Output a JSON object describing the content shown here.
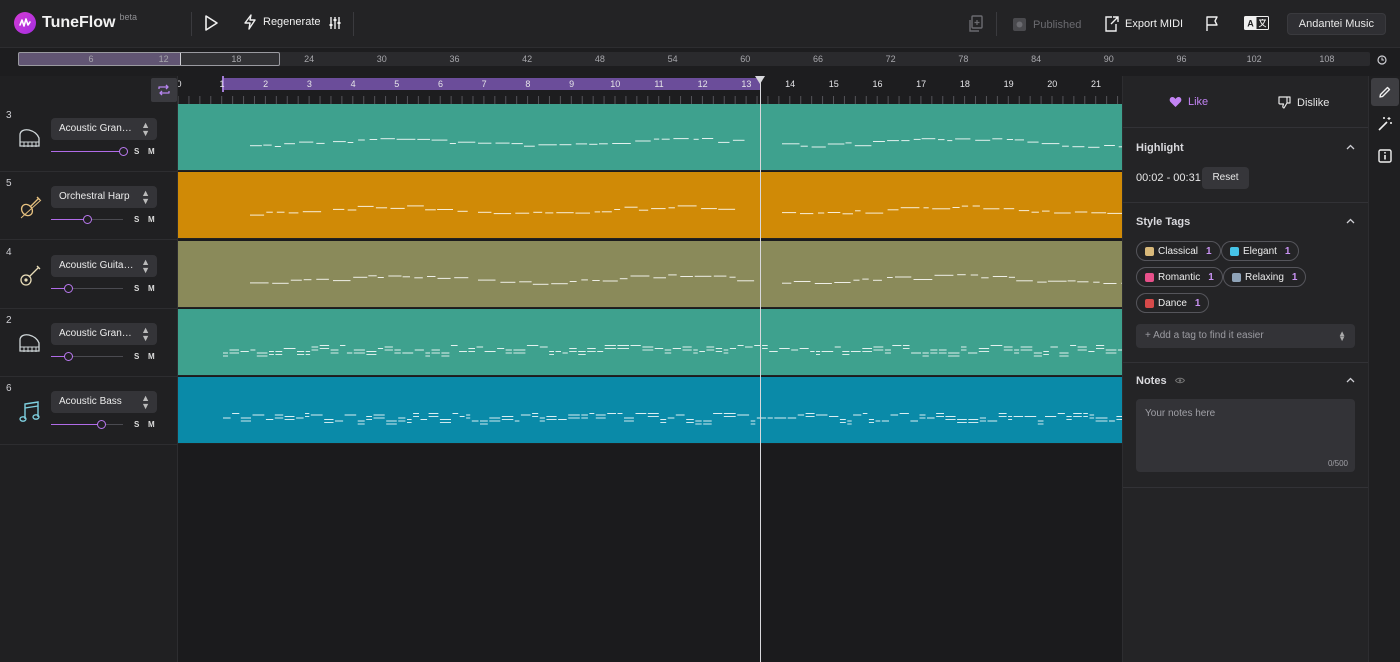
{
  "app": {
    "name": "TuneFlow",
    "badge": "beta"
  },
  "toolbar": {
    "regenerate_label": "Regenerate",
    "published_label": "Published",
    "export_label": "Export MIDI",
    "account_label": "Andantei Music"
  },
  "overview": {
    "labels": [
      "6",
      "12",
      "18",
      "24",
      "30",
      "36",
      "42",
      "48",
      "54",
      "60",
      "66",
      "72",
      "78",
      "84",
      "90",
      "96",
      "102",
      "108"
    ]
  },
  "ruler": {
    "labels": [
      "0",
      "1",
      "2",
      "3",
      "4",
      "5",
      "6",
      "7",
      "8",
      "9",
      "10",
      "11",
      "12",
      "13",
      "14",
      "15",
      "16",
      "17",
      "18",
      "19",
      "20",
      "21"
    ]
  },
  "tracks": [
    {
      "number": "3",
      "instrument": "Acoustic Gran…",
      "icon": "piano-icon",
      "volume": 1.0,
      "solo": "S",
      "mute": "M",
      "color": "#3ea18e"
    },
    {
      "number": "5",
      "instrument": "Orchestral Harp",
      "icon": "violin-icon",
      "volume": 0.5,
      "solo": "S",
      "mute": "M",
      "color": "#d08a06"
    },
    {
      "number": "4",
      "instrument": "Acoustic Guita…",
      "icon": "guitar-icon",
      "volume": 0.24,
      "solo": "S",
      "mute": "M",
      "color": "#8a8a5a"
    },
    {
      "number": "2",
      "instrument": "Acoustic Gran…",
      "icon": "piano-icon",
      "volume": 0.24,
      "solo": "S",
      "mute": "M",
      "color": "#3ea18e"
    },
    {
      "number": "6",
      "instrument": "Acoustic Bass",
      "icon": "music-note-icon",
      "volume": 0.7,
      "solo": "S",
      "mute": "M",
      "color": "#0a8aa8"
    }
  ],
  "panel": {
    "like_label": "Like",
    "dislike_label": "Dislike",
    "highlight": {
      "title": "Highlight",
      "range": "00:02 - 00:31",
      "reset_label": "Reset"
    },
    "style_tags": {
      "title": "Style Tags",
      "tags": [
        {
          "label": "Classical",
          "count": "1",
          "color": "#d9b97a"
        },
        {
          "label": "Elegant",
          "count": "1",
          "color": "#46c4e8"
        },
        {
          "label": "Romantic",
          "count": "1",
          "color": "#e8508a"
        },
        {
          "label": "Relaxing",
          "count": "1",
          "color": "#8fa3b8"
        },
        {
          "label": "Dance",
          "count": "1",
          "color": "#d64a4a"
        }
      ],
      "input_placeholder": "+ Add a tag to find it easier"
    },
    "notes": {
      "title": "Notes",
      "placeholder": "Your notes here",
      "counter": "0/500"
    }
  }
}
